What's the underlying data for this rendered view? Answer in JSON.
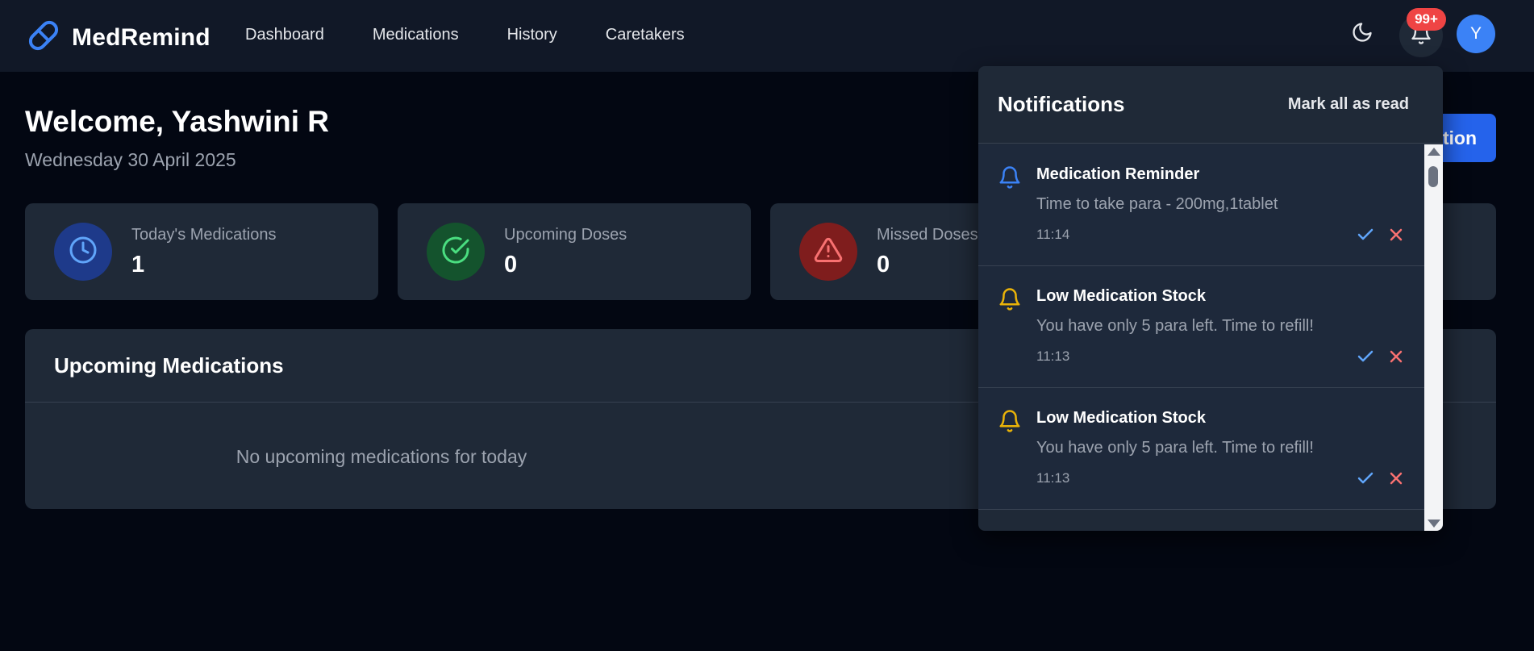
{
  "app": {
    "name": "MedRemind"
  },
  "nav": {
    "links": [
      {
        "label": "Dashboard"
      },
      {
        "label": "Medications"
      },
      {
        "label": "History"
      },
      {
        "label": "Caretakers"
      }
    ]
  },
  "header": {
    "theme_icon": "moon-icon",
    "notification_badge": "99+",
    "avatar_initial": "Y"
  },
  "welcome": {
    "greeting": "Welcome, Yashwini R",
    "date": "Wednesday 30 April 2025",
    "action_label_visible": "tion"
  },
  "stats": [
    {
      "label": "Today's Medications",
      "value": "1",
      "icon": "clock-icon",
      "color": "#3b82f6"
    },
    {
      "label": "Upcoming Doses",
      "value": "0",
      "icon": "check-circle-icon",
      "color": "#22c55e"
    },
    {
      "label": "Missed Doses",
      "value": "0",
      "icon": "warning-icon",
      "color": "#ef4444"
    }
  ],
  "upcoming": {
    "title": "Upcoming Medications",
    "empty_text": "No upcoming medications for today"
  },
  "notifications": {
    "title": "Notifications",
    "mark_all_label": "Mark all as read",
    "items": [
      {
        "title": "Medication Reminder",
        "message": "Time to take para - 200mg,1tablet",
        "time": "11:14",
        "icon": "bell-icon",
        "color": "#3b82f6"
      },
      {
        "title": "Low Medication Stock",
        "message": "You have only 5 para left. Time to refill!",
        "time": "11:13",
        "icon": "bell-icon",
        "color": "#eab308"
      },
      {
        "title": "Low Medication Stock",
        "message": "You have only 5 para left. Time to refill!",
        "time": "11:13",
        "icon": "bell-icon",
        "color": "#eab308"
      }
    ]
  },
  "colors": {
    "background": "#030712",
    "surface": "#1f2937",
    "accent": "#2563eb",
    "badge": "#ef4444"
  }
}
